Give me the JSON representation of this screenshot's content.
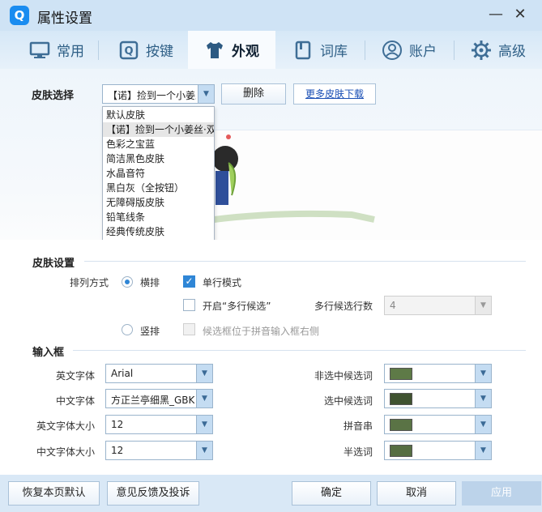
{
  "window": {
    "title": "属性设置",
    "logo_letter": "Q",
    "minimize": "—",
    "close": "✕"
  },
  "tabs": [
    {
      "label": "常用",
      "icon": "monitor-icon",
      "active": false
    },
    {
      "label": "按键",
      "icon": "keyboard-icon",
      "active": false
    },
    {
      "label": "外观",
      "icon": "tshirt-icon",
      "active": true
    },
    {
      "label": "词库",
      "icon": "book-icon",
      "active": false
    },
    {
      "label": "账户",
      "icon": "user-icon",
      "active": false
    },
    {
      "label": "高级",
      "icon": "gear-icon",
      "active": false
    }
  ],
  "skin": {
    "label": "皮肤选择",
    "selected": "【诺】捡到一个小姜丝·双",
    "delete_label": "删除",
    "more_label": "更多皮肤下载",
    "options": [
      "默认皮肤",
      "【诺】捡到一个小姜丝·双",
      "色彩之宝蓝",
      "简洁黑色皮肤",
      "水晶音符",
      "黑白灰（全按钮）",
      "无障碍版皮肤",
      "铅笔线条",
      "经典传统皮肤"
    ]
  },
  "skin_settings": {
    "title": "皮肤设置",
    "arrange_label": "排列方式",
    "horizontal_label": "横排",
    "vertical_label": "竖排",
    "single_line_label": "单行模式",
    "multi_line_label": "开启“多行候选”",
    "multi_line_count_label": "多行候选行数",
    "multi_line_count": "4",
    "candidate_right_label": "候选框位于拼音输入框右侧"
  },
  "input_box": {
    "title": "输入框",
    "en_font_label": "英文字体",
    "en_font": "Arial",
    "cn_font_label": "中文字体",
    "cn_font": "方正兰亭细黑_GBK",
    "en_size_label": "英文字体大小",
    "en_size": "12",
    "cn_size_label": "中文字体大小",
    "cn_size": "12",
    "unselected_label": "非选中候选词",
    "selected_label": "选中候选词",
    "pinyin_label": "拼音串",
    "half_label": "半选词",
    "colors": {
      "unselected": "#5e7a47",
      "selected": "#3f5230",
      "pinyin": "#5a7345",
      "half": "#566e42"
    }
  },
  "footer": {
    "restore_label": "恢复本页默认",
    "feedback_label": "意见反馈及投诉",
    "ok_label": "确定",
    "cancel_label": "取消",
    "apply_label": "应用"
  }
}
